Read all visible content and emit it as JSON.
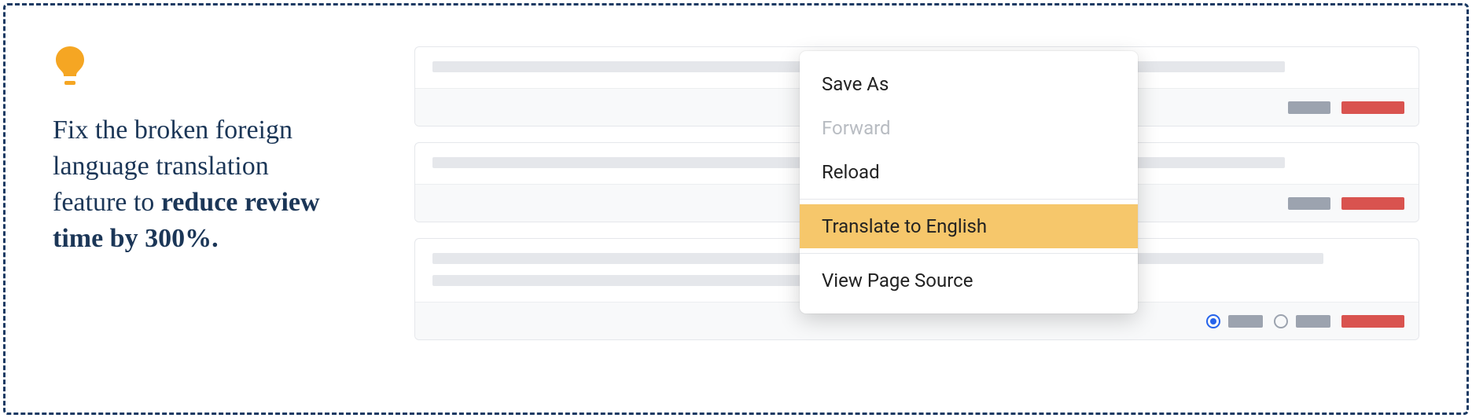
{
  "left": {
    "headline_prefix": "Fix the broken foreign language translation feature to ",
    "headline_bold": "reduce review time by 300%."
  },
  "menu": {
    "save_as": "Save As",
    "forward": "Forward",
    "reload": "Reload",
    "translate": "Translate to English",
    "view_source": "View Page Source"
  },
  "colors": {
    "accent_orange": "#f5a623",
    "highlight": "#f6c76b",
    "danger": "#d9534f",
    "frame_border": "#1b3a63"
  }
}
